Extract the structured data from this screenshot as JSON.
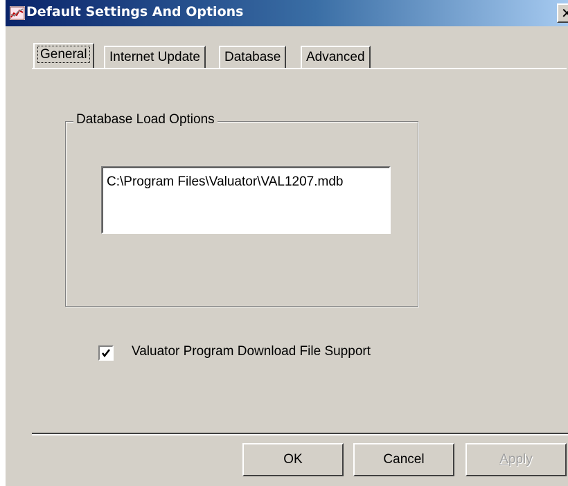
{
  "window": {
    "title": "Default Settings And Options",
    "close_glyph": "✕",
    "title_icon": "chart-icon"
  },
  "tabs": [
    {
      "label": "General",
      "active": true
    },
    {
      "label": "Internet Update",
      "active": false
    },
    {
      "label": "Database",
      "active": false
    },
    {
      "label": "Advanced",
      "active": false
    }
  ],
  "database_group": {
    "legend": "Database Load Options",
    "path_value": "C:\\Program Files\\Valuator\\VAL1207.mdb"
  },
  "download_support": {
    "label": "Valuator Program Download  File Support",
    "checked": true
  },
  "buttons": {
    "ok": "OK",
    "cancel": "Cancel",
    "apply": "Apply",
    "apply_enabled": false
  },
  "colors": {
    "titlebar_start": "#0a246a",
    "titlebar_end": "#a6caf0",
    "face": "#d4d0c8"
  }
}
